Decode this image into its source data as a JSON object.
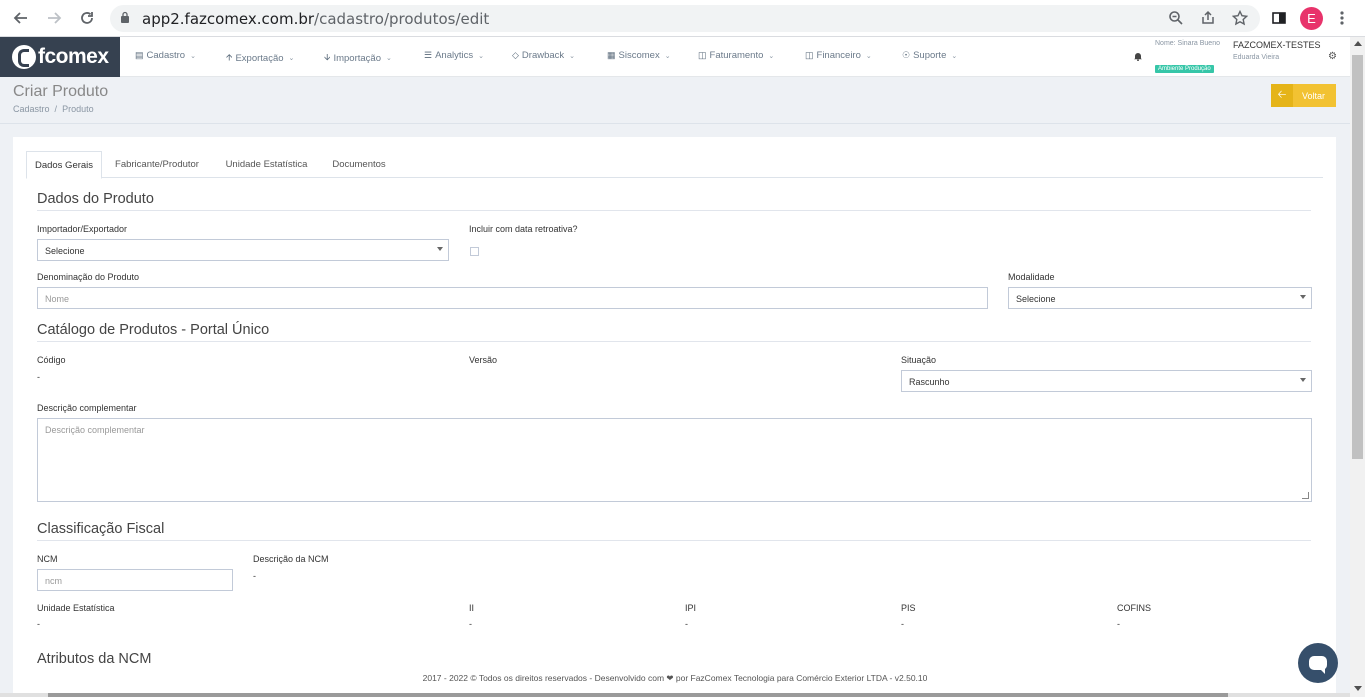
{
  "browser": {
    "url_host": "app2.fazcomex.com.br",
    "url_path": "/cadastro/produtos/edit",
    "profile_initial": "E"
  },
  "header": {
    "logo_text": "fcomex",
    "menu": [
      {
        "label": "Cadastro",
        "icon": "id-card-icon"
      },
      {
        "label": "Exportação",
        "icon": "arrow-up-icon"
      },
      {
        "label": "Importação",
        "icon": "arrow-down-icon"
      },
      {
        "label": "Analytics",
        "icon": "database-icon"
      },
      {
        "label": "Drawback",
        "icon": "diamond-icon"
      },
      {
        "label": "Siscomex",
        "icon": "grid-icon"
      },
      {
        "label": "Faturamento",
        "icon": "money-icon"
      },
      {
        "label": "Financeiro",
        "icon": "money-icon"
      },
      {
        "label": "Suporte",
        "icon": "lifebuoy-icon"
      }
    ],
    "user_name": "Nome: Sinara Bueno",
    "env_badge": "Ambiente Produção",
    "company": "FAZCOMEX-TESTES",
    "company_user": "Eduarda Vieira"
  },
  "page": {
    "title": "Criar Produto",
    "breadcrumb_1": "Cadastro",
    "breadcrumb_sep": "/",
    "breadcrumb_2": "Produto",
    "back_label": "Voltar"
  },
  "tabs": [
    "Dados Gerais",
    "Fabricante/Produtor",
    "Unidade Estatística",
    "Documentos"
  ],
  "dados_produto": {
    "title": "Dados do Produto",
    "importador_label": "Importador/Exportador",
    "importador_value": "Selecione",
    "retroativa_label": "Incluir com data retroativa?",
    "denominacao_label": "Denominação do Produto",
    "denominacao_placeholder": "Nome",
    "modalidade_label": "Modalidade",
    "modalidade_value": "Selecione"
  },
  "catalogo": {
    "title": "Catálogo de Produtos - Portal Único",
    "codigo_label": "Código",
    "codigo_value": "-",
    "versao_label": "Versão",
    "situacao_label": "Situação",
    "situacao_value": "Rascunho",
    "descricao_label": "Descrição complementar",
    "descricao_placeholder": "Descrição complementar"
  },
  "fiscal": {
    "title": "Classificação Fiscal",
    "ncm_label": "NCM",
    "ncm_placeholder": "ncm",
    "desc_ncm_label": "Descrição da NCM",
    "desc_ncm_value": "-",
    "unidade_label": "Unidade Estatística",
    "unidade_value": "-",
    "ii_label": "II",
    "ii_value": "-",
    "ipi_label": "IPI",
    "ipi_value": "-",
    "pis_label": "PIS",
    "pis_value": "-",
    "cofins_label": "COFINS",
    "cofins_value": "-"
  },
  "atributos": {
    "title": "Atributos da NCM"
  },
  "footer": {
    "text": "2017 - 2022 © Todos os direitos reservados - Desenvolvido com ❤ por FazComex Tecnologia para Comércio Exterior LTDA - v2.50.10"
  }
}
